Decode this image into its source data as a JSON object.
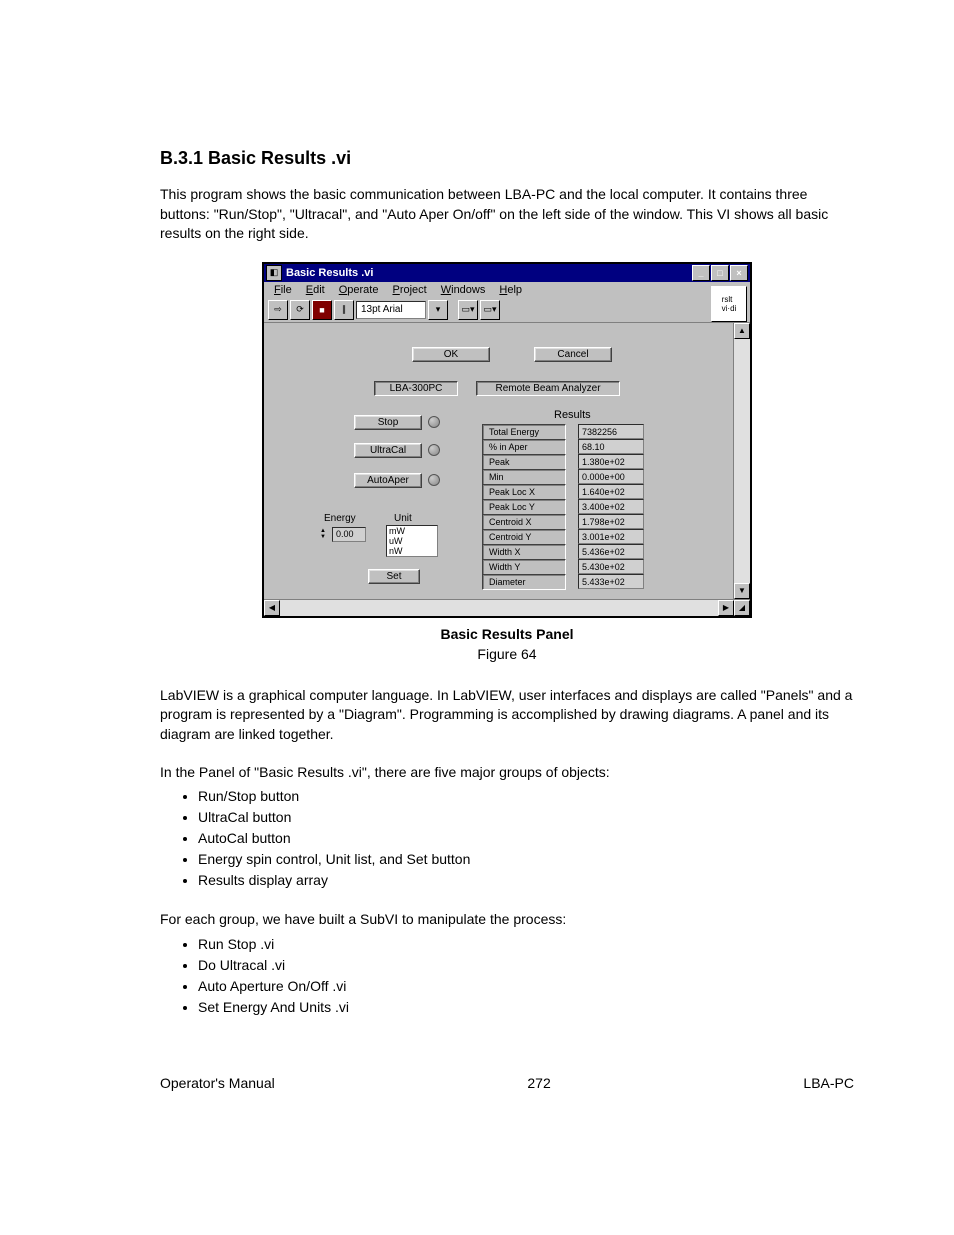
{
  "heading": "B.3.1   Basic Results .vi",
  "para1": "This program shows the basic communication between LBA-PC and the local computer. It contains three buttons: \"Run/Stop\", \"Ultracal\", and \"Auto Aper On/off\" on the left side of the window.  This VI shows all basic results on the right side.",
  "screenshot": {
    "title": "Basic Results .vi",
    "menu": [
      "File",
      "Edit",
      "Operate",
      "Project",
      "Windows",
      "Help"
    ],
    "font_label": "13pt Arial",
    "icon_text": "rslt\nvi-di",
    "buttons": {
      "ok": "OK",
      "cancel": "Cancel"
    },
    "banner": {
      "left": "LBA-300PC",
      "right": "Remote Beam Analyzer"
    },
    "left_btns": {
      "stop": "Stop",
      "ultracal": "UltraCal",
      "autoaper": "AutoAper"
    },
    "energy": {
      "label": "Energy",
      "value": "0.00",
      "unit_label": "Unit",
      "units": [
        "mW",
        "uW",
        "nW"
      ],
      "set": "Set"
    },
    "results": {
      "title": "Results",
      "rows": [
        {
          "label": "Total Energy",
          "value": "7382256"
        },
        {
          "label": "% in Aper",
          "value": "68.10"
        },
        {
          "label": "Peak",
          "value": "1.380e+02"
        },
        {
          "label": "Min",
          "value": "0.000e+00"
        },
        {
          "label": "Peak Loc X",
          "value": "1.640e+02"
        },
        {
          "label": "Peak Loc Y",
          "value": "3.400e+02"
        },
        {
          "label": "Centroid X",
          "value": "1.798e+02"
        },
        {
          "label": "Centroid Y",
          "value": "3.001e+02"
        },
        {
          "label": "Width X",
          "value": "5.436e+02"
        },
        {
          "label": "Width Y",
          "value": "5.430e+02"
        },
        {
          "label": "Diameter",
          "value": "5.433e+02"
        }
      ]
    }
  },
  "caption": "Basic Results Panel",
  "figure": "Figure 64",
  "para2": "LabVIEW is a graphical computer language.  In LabVIEW, user interfaces and displays are called  \"Panels\" and a program is represented by a \"Diagram\".  Programming is accomplished by drawing diagrams. A panel and its diagram are linked together.",
  "para3": "In the Panel of \"Basic Results .vi\", there are five major groups of objects:",
  "list1": [
    "Run/Stop button",
    "UltraCal button",
    "AutoCal button",
    "Energy spin control, Unit list, and Set button",
    "Results display array"
  ],
  "para4": "For each group, we have built a SubVI to manipulate the process:",
  "list2": [
    "Run Stop .vi",
    "Do Ultracal .vi",
    "Auto Aperture On/Off .vi",
    "Set Energy And Units .vi"
  ],
  "footer": {
    "left": "Operator's Manual",
    "center": "272",
    "right": "LBA-PC"
  }
}
